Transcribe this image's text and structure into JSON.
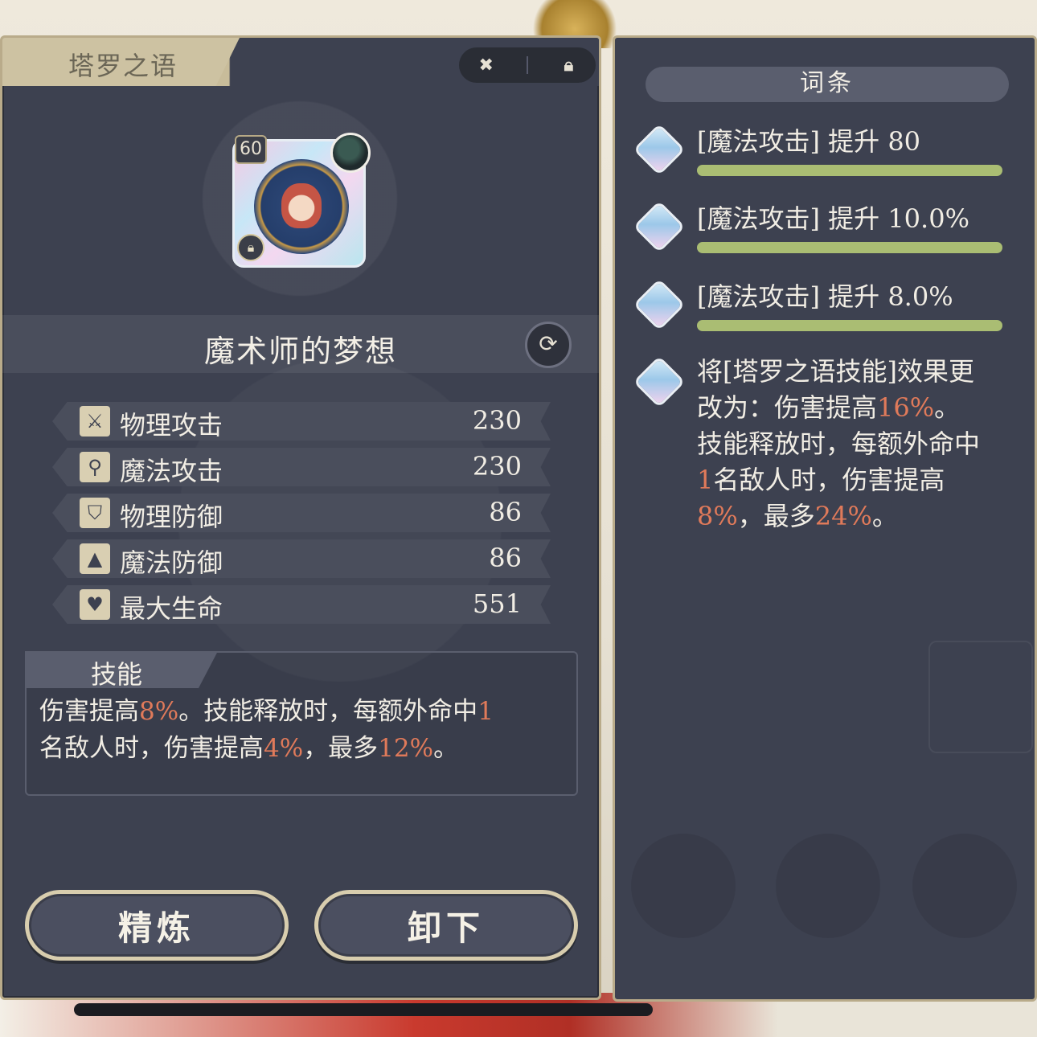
{
  "panel": {
    "title": "塔罗之语",
    "card_level": "60",
    "item_name": "魔术师的梦想"
  },
  "stats": [
    {
      "label": "物理攻击",
      "value": "230",
      "icon": "sword-icon"
    },
    {
      "label": "魔法攻击",
      "value": "230",
      "icon": "wand-icon"
    },
    {
      "label": "物理防御",
      "value": "86",
      "icon": "shield-icon"
    },
    {
      "label": "魔法防御",
      "value": "86",
      "icon": "wizard-hat-icon"
    },
    {
      "label": "最大生命",
      "value": "551",
      "icon": "heart-icon"
    }
  ],
  "skill": {
    "title": "技能",
    "line1": {
      "a": "伤害提高",
      "b": "8%",
      "c": "。技能释放时，每额外命中",
      "d": "1"
    },
    "line2": {
      "a": "名敌人时，伤害提高",
      "b": "4%",
      "c": "，最多",
      "d": "12%",
      "e": "。"
    }
  },
  "buttons": {
    "refine": "精炼",
    "unequip": "卸下"
  },
  "entries": {
    "header": "词条",
    "items": [
      {
        "text": "[魔法攻击] 提升 80",
        "progress": 1.0
      },
      {
        "text": "[魔法攻击] 提升 10.0%",
        "progress": 1.0
      },
      {
        "text": "[魔法攻击] 提升 8.0%",
        "progress": 1.0
      }
    ],
    "desc": {
      "l1": "将[塔罗之语技能]效果更",
      "l2a": "改为：伤害提高",
      "l2b": "16%",
      "l2c": "。",
      "l3": "技能释放时，每额外命中",
      "l4a": "1",
      "l4b": "名敌人时，伤害提高",
      "l5a": "8%",
      "l5b": "，最多",
      "l5c": "24%",
      "l5d": "。"
    }
  },
  "colors": {
    "panel_bg": "#3d4150",
    "highlight": "#e07a5a",
    "progress_bar": "#aabd73",
    "frame": "#b9ab8a"
  }
}
